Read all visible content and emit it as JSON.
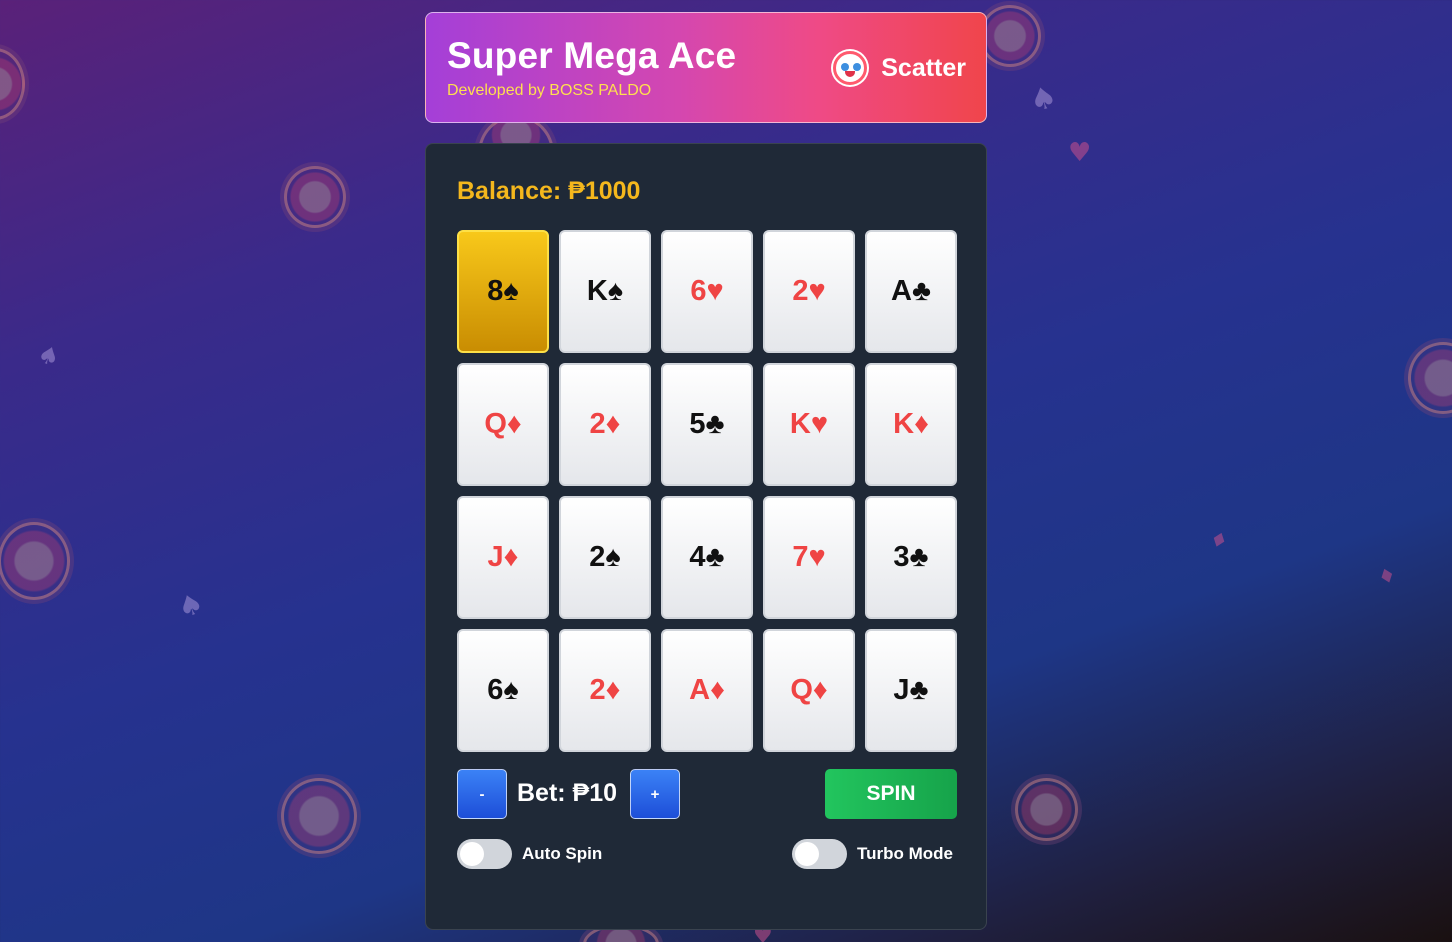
{
  "header": {
    "title": "Super Mega Ace",
    "subtitle": "Developed by BOSS PALDO",
    "scatter_icon": "clown-face-icon",
    "scatter_label": "Scatter"
  },
  "game": {
    "balance_label": "Balance: ₱1000",
    "grid": [
      [
        {
          "text": "8♠",
          "color": "black",
          "highlight": true
        },
        {
          "text": "K♠",
          "color": "black"
        },
        {
          "text": "6♥",
          "color": "red"
        },
        {
          "text": "2♥",
          "color": "red"
        },
        {
          "text": "A♣",
          "color": "black"
        }
      ],
      [
        {
          "text": "Q♦",
          "color": "red"
        },
        {
          "text": "2♦",
          "color": "red"
        },
        {
          "text": "5♣",
          "color": "black"
        },
        {
          "text": "K♥",
          "color": "red"
        },
        {
          "text": "K♦",
          "color": "red"
        }
      ],
      [
        {
          "text": "J♦",
          "color": "red"
        },
        {
          "text": "2♠",
          "color": "black"
        },
        {
          "text": "4♣",
          "color": "black"
        },
        {
          "text": "7♥",
          "color": "red"
        },
        {
          "text": "3♣",
          "color": "black"
        }
      ],
      [
        {
          "text": "6♠",
          "color": "black"
        },
        {
          "text": "2♦",
          "color": "red"
        },
        {
          "text": "A♦",
          "color": "red"
        },
        {
          "text": "Q♦",
          "color": "red"
        },
        {
          "text": "J♣",
          "color": "black"
        }
      ]
    ],
    "controls": {
      "decrease_label": "-",
      "bet_label": "Bet: ₱10",
      "increase_label": "+",
      "spin_label": "SPIN"
    },
    "toggles": {
      "auto_spin_label": "Auto Spin",
      "auto_spin_on": false,
      "turbo_label": "Turbo Mode",
      "turbo_on": false
    }
  },
  "colors": {
    "balance": "#f4b71d",
    "red_suit": "#ef4444",
    "spin": "#22c55e",
    "bet_buttons": "#3b82f6"
  }
}
